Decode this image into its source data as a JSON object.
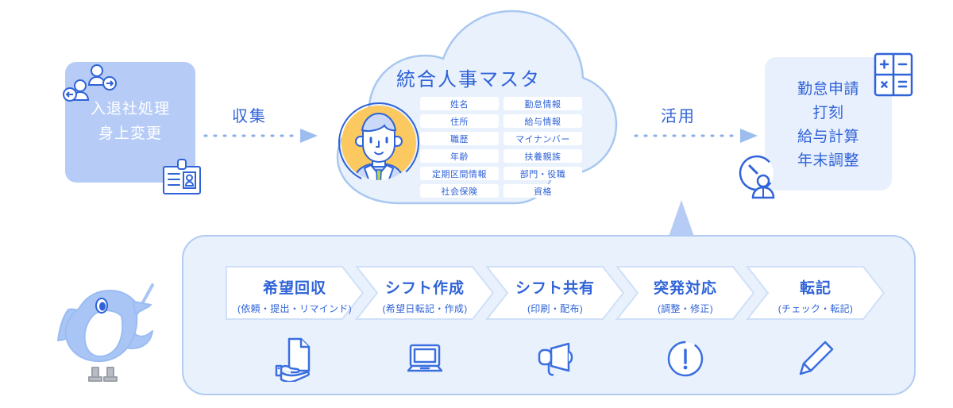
{
  "colors": {
    "accent_blue": "#2f63d8",
    "light_blue_fill": "#e9f1fd",
    "mid_blue_fill": "#b6ccf7",
    "border_blue": "#b2cbf2",
    "avatar_orange": "#fbc95f",
    "tie_green": "#b5d44a",
    "white": "#ffffff"
  },
  "left_box": {
    "text": "入退社処理\n身上変更",
    "icon_top": "people-in-out-icon",
    "icon_bottom": "id-card-icon"
  },
  "flow": {
    "collect_label": "収集",
    "utilize_label": "活用"
  },
  "cloud": {
    "title": "統合人事マスタ",
    "avatar": "person-avatar",
    "fields_left": [
      "姓名",
      "住所",
      "職歴",
      "年齢",
      "定期区間情報",
      "社会保険"
    ],
    "fields_right": [
      "勤怠情報",
      "給与情報",
      "マイナンバー",
      "扶養親族",
      "部門・役職",
      "資格"
    ]
  },
  "right_box": {
    "text": "勤怠申請\n打刻\n給与計算\n年末調整",
    "icon_top": "calculator-icon",
    "icon_bottom": "clock-person-icon"
  },
  "panel": {
    "steps": [
      {
        "title": "希望回収",
        "sub": "(依頼・提出・リマインド)",
        "icon": "hand-document-icon"
      },
      {
        "title": "シフト作成",
        "sub": "(希望日転記・作成)",
        "icon": "laptop-icon"
      },
      {
        "title": "シフト共有",
        "sub": "(印刷・配布)",
        "icon": "megaphone-icon"
      },
      {
        "title": "突発対応",
        "sub": "(調整・修正)",
        "icon": "exclamation-circle-icon"
      },
      {
        "title": "転記",
        "sub": "(チェック・転記)",
        "icon": "pencil-icon"
      }
    ]
  },
  "mascot": {
    "name": "bird-mascot"
  }
}
